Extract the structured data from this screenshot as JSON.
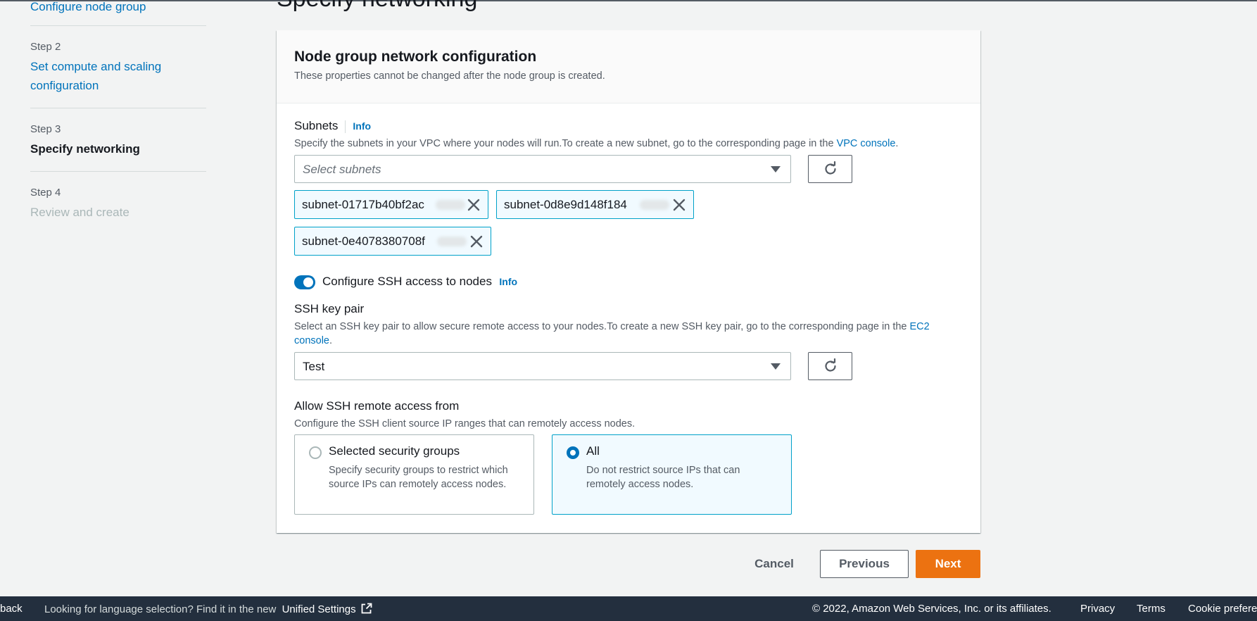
{
  "nav": {
    "step1_link": "Configure node group",
    "step2_label": "Step 2",
    "step2_link": "Set compute and scaling configuration",
    "step3_label": "Step 3",
    "step3_current": "Specify networking",
    "step4_label": "Step 4",
    "step4_disabled": "Review and create"
  },
  "page_title": "Specify networking",
  "panel": {
    "title": "Node group network configuration",
    "subtitle": "These properties cannot be changed after the node group is created."
  },
  "subnets": {
    "label": "Subnets",
    "info": "Info",
    "desc": "Specify the subnets in your VPC where your nodes will run.To create a new subnet, go to the corresponding page in the",
    "desc_link": "VPC console",
    "desc_end": ".",
    "placeholder": "Select subnets",
    "tokens": [
      "subnet-01717b40bf2ac",
      "subnet-0d8e9d148f184",
      "subnet-0e4078380708f"
    ]
  },
  "ssh_toggle": {
    "label": "Configure SSH access to nodes",
    "info": "Info",
    "on": true
  },
  "ssh_key": {
    "label": "SSH key pair",
    "desc": "Select an SSH key pair to allow secure remote access to your nodes.To create a new SSH key pair, go to the corresponding page in the",
    "desc_link1": "EC2",
    "desc_link2": "console",
    "desc_end": ".",
    "value": "Test"
  },
  "remote_access": {
    "label": "Allow SSH remote access from",
    "desc": "Configure the SSH client source IP ranges that can remotely access nodes.",
    "option1_title": "Selected security groups",
    "option1_desc": "Specify security groups to restrict which source IPs can remotely access nodes.",
    "option2_title": "All",
    "option2_desc": "Do not restrict source IPs that can remotely access nodes.",
    "selected": "All"
  },
  "actions": {
    "cancel": "Cancel",
    "previous": "Previous",
    "next": "Next"
  },
  "footer": {
    "feedback": "back",
    "lang_text": "Looking for language selection? Find it in the new",
    "unified": "Unified Settings",
    "copyright": "© 2022, Amazon Web Services, Inc. or its affiliates.",
    "privacy": "Privacy",
    "terms": "Terms",
    "cookie": "Cookie prefere"
  },
  "colors": {
    "accent": "#0073bb",
    "primary": "#ec7211",
    "footer_bg": "#232f3e"
  }
}
